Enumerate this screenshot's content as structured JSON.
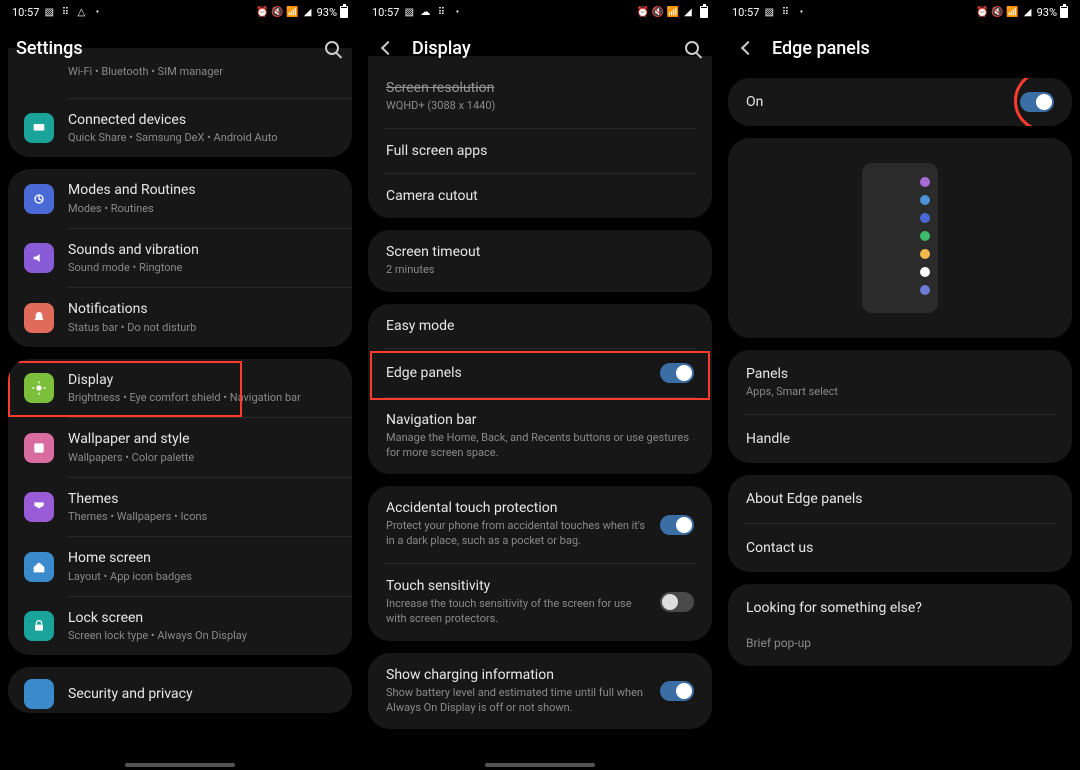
{
  "status": {
    "time": "10:57",
    "battery_text": "93%",
    "left_icons": [
      "image-icon",
      "apps-icon",
      "cloud-icon",
      "dot-icon"
    ],
    "left_icons_b": [
      "image-icon",
      "cloud-icon",
      "apps-icon",
      "dot-icon"
    ],
    "left_icons_c": [
      "image-icon",
      "apps-icon",
      "dot-icon"
    ],
    "right_icons": [
      "alarm-icon",
      "mute-icon",
      "wifi-icon",
      "signal-icon"
    ]
  },
  "pane1": {
    "header": "Settings",
    "top_truncated": {
      "sub": "Wi-Fi  •  Bluetooth  •  SIM manager"
    },
    "group_a": [
      {
        "icon_bg": "#1aa39a",
        "label": "Connected devices",
        "sub": "Quick Share  •  Samsung DeX  •  Android Auto"
      }
    ],
    "group_b": [
      {
        "icon_bg": "#4a6bd6",
        "label": "Modes and Routines",
        "sub": "Modes  •  Routines"
      },
      {
        "icon_bg": "#8a5bd6",
        "label": "Sounds and vibration",
        "sub": "Sound mode  •  Ringtone"
      },
      {
        "icon_bg": "#e06b5b",
        "label": "Notifications",
        "sub": "Status bar  •  Do not disturb"
      }
    ],
    "group_c": [
      {
        "icon_bg": "#7bbf3a",
        "label": "Display",
        "sub": "Brightness  •  Eye comfort shield  •  Navigation bar"
      },
      {
        "icon_bg": "#d86ba0",
        "label": "Wallpaper and style",
        "sub": "Wallpapers  •  Color palette"
      },
      {
        "icon_bg": "#9a5bd6",
        "label": "Themes",
        "sub": "Themes  •  Wallpapers  •  Icons"
      },
      {
        "icon_bg": "#3a8acc",
        "label": "Home screen",
        "sub": "Layout  •  App icon badges"
      },
      {
        "icon_bg": "#1aa39a",
        "label": "Lock screen",
        "sub": "Screen lock type  •  Always On Display"
      }
    ],
    "group_d_peek": "Security and privacy"
  },
  "pane2": {
    "header": "Display",
    "top_cut": {
      "title": "Screen resolution",
      "sub": "WQHD+ (3088 x 1440)"
    },
    "card_a": [
      {
        "title": "Full screen apps"
      },
      {
        "title": "Camera cutout"
      }
    ],
    "card_b": [
      {
        "title": "Screen timeout",
        "sub": "2 minutes"
      }
    ],
    "card_c": [
      {
        "title": "Easy mode"
      },
      {
        "title": "Edge panels",
        "toggle": true,
        "on": true
      },
      {
        "title": "Navigation bar",
        "sub": "Manage the Home, Back, and Recents buttons or use gestures for more screen space."
      }
    ],
    "card_d": [
      {
        "title": "Accidental touch protection",
        "sub": "Protect your phone from accidental touches when it's in a dark place, such as a pocket or bag.",
        "toggle": true,
        "on": true
      },
      {
        "title": "Touch sensitivity",
        "sub": "Increase the touch sensitivity of the screen for use with screen protectors.",
        "toggle": true,
        "on": false
      }
    ],
    "card_e": [
      {
        "title": "Show charging information",
        "sub": "Show battery level and estimated time until full when Always On Display is off or not shown.",
        "toggle": true,
        "on": true
      }
    ]
  },
  "pane3": {
    "header": "Edge panels",
    "master": {
      "label": "On",
      "on": true
    },
    "preview_colors": [
      "#a96ad8",
      "#4a94d6",
      "#4a6bd6",
      "#3dbb6a",
      "#f2b84a",
      "#ffffff",
      "#6b7bd6"
    ],
    "card_a": [
      {
        "label": "Panels",
        "sub": "Apps, Smart select"
      },
      {
        "label": "Handle"
      }
    ],
    "card_b": [
      {
        "label": "About Edge panels"
      },
      {
        "label": "Contact us"
      }
    ],
    "looking": {
      "title": "Looking for something else?",
      "items": [
        "Brief pop-up"
      ]
    }
  }
}
